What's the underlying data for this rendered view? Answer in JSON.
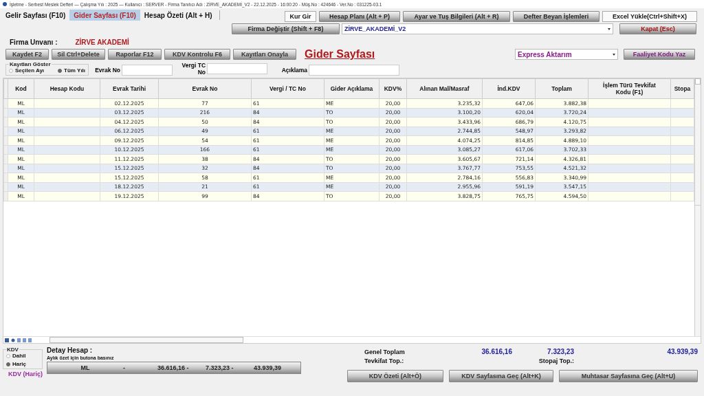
{
  "window": {
    "title": "İşletme - Serbest Meslek Defteri — Çalışma Yılı : 2025 — Kullanıcı : SERVER - Firma Tanıtıcı Adı : ZİRVE_AKADEMİ_V2 - 22.12.2025 - 16:00:20 - Müş.No : 424646 - Ver.No : 031225-03.1"
  },
  "tabs": [
    {
      "label": "Gelir Sayfası (F10)",
      "selected": false
    },
    {
      "label": "Gider Sayfası (F10)",
      "selected": true
    },
    {
      "label": "Hesap Özeti (Alt + H)",
      "selected": false
    }
  ],
  "top_buttons": [
    "Kur Gir",
    "Hesap Planı (Alt + P)",
    "Ayar ve Tuş Bilgileri (Alt + R)",
    "Defter Beyan İşlemleri",
    "Excel Yükle(Ctrl+Shift+X)"
  ],
  "firma_button": "Firma Değiştir (Shift + F8)",
  "firma_select": "ZİRVE_AKADEMİ_V2",
  "close_button": "Kapat (Esc)",
  "firma_label": "Firma Unvanı :",
  "firma_name": "ZİRVE AKADEMİ",
  "action_buttons": [
    "Kaydet F2",
    "Sil Ctrl+Delete",
    "Raporlar F12",
    "KDV Kontrolu F6",
    "Kayıtları Onayla"
  ],
  "page_title": "Gider Sayfası",
  "transfer_select": "Express Aktarım",
  "activity_button": "Faaliyet Kodu Yaz",
  "filter_group": {
    "title": "Kayıtları Göster",
    "options": [
      {
        "label": "Seçilen Ayı",
        "selected": false
      },
      {
        "label": "Tüm Yılı",
        "selected": true
      }
    ]
  },
  "filters": [
    {
      "label": "Evrak No"
    },
    {
      "label": "Vergi TC No"
    },
    {
      "label": "Açıklama"
    }
  ],
  "table": {
    "columns": [
      "Kod",
      "Hesap Kodu",
      "Evrak Tarihi",
      "Evrak No",
      "Vergi / TC No",
      "Gider Açıklama",
      "KDV%",
      "Alınan Mal/Masraf",
      "İnd.KDV",
      "Toplam",
      "İşlem Türü Tevkifat Kodu (F1)",
      "Stopa"
    ],
    "rows": [
      [
        "ML",
        "",
        "02.12.2025",
        "77",
        "61",
        "ME",
        "20,00",
        "3.235,32",
        "647,06",
        "3.882,38",
        "",
        ""
      ],
      [
        "ML",
        "",
        "03.12.2025",
        "216",
        "84",
        "TO",
        "20,00",
        "3.100,20",
        "620,04",
        "3.720,24",
        "",
        ""
      ],
      [
        "ML",
        "",
        "04.12.2025",
        "50",
        "84",
        "TO",
        "20,00",
        "3.433,96",
        "686,79",
        "4.120,75",
        "",
        ""
      ],
      [
        "ML",
        "",
        "06.12.2025",
        "49",
        "61",
        "ME",
        "20,00",
        "2.744,85",
        "548,97",
        "3.293,82",
        "",
        ""
      ],
      [
        "ML",
        "",
        "09.12.2025",
        "54",
        "61",
        "ME",
        "20,00",
        "4.074,25",
        "814,85",
        "4.889,10",
        "",
        ""
      ],
      [
        "ML",
        "",
        "10.12.2025",
        "166",
        "61",
        "ME",
        "20,00",
        "3.085,27",
        "617,06",
        "3.702,33",
        "",
        ""
      ],
      [
        "ML",
        "",
        "11.12.2025",
        "38",
        "84",
        "TO",
        "20,00",
        "3.605,67",
        "721,14",
        "4.326,81",
        "",
        ""
      ],
      [
        "ML",
        "",
        "15.12.2025",
        "32",
        "84",
        "TO",
        "20,00",
        "3.767,77",
        "753,55",
        "4.521,32",
        "",
        ""
      ],
      [
        "ML",
        "",
        "15.12.2025",
        "58",
        "61",
        "ME",
        "20,00",
        "2.784,16",
        "556,83",
        "3.340,99",
        "",
        ""
      ],
      [
        "ML",
        "",
        "18.12.2025",
        "21",
        "61",
        "ME",
        "20,00",
        "2.955,96",
        "591,19",
        "3.547,15",
        "",
        ""
      ],
      [
        "ML",
        "",
        "19.12.2025",
        "99",
        "84",
        "TO",
        "20,00",
        "3.828,75",
        "765,75",
        "4.594,50",
        "",
        ""
      ]
    ]
  },
  "kdv_group": {
    "title": "KDV",
    "options": [
      {
        "label": "Dahil",
        "selected": false
      },
      {
        "label": "Hariç",
        "selected": true
      }
    ],
    "note": "KDV (Hariç)"
  },
  "detail": {
    "title": "Detay Hesap :",
    "hint": "Aylık özet için butona basınız",
    "summary": [
      "ML",
      "-",
      "36.616,16 -",
      "7.323,23 -",
      "43.939,39"
    ]
  },
  "totals": {
    "genel_label": "Genel Toplam",
    "genel_values": [
      "36.616,16",
      "7.323,23",
      "43.939,39"
    ],
    "tevkifat_label": "Tevkifat  Top.:",
    "stopaj_label": "Stopaj  Top.:"
  },
  "bottom_buttons": [
    "KDV Özeti (Alt+Ö)",
    "KDV Sayfasına Geç (Alt+K)",
    "Muhtasar Sayfasına Geç (Alt+U)"
  ]
}
